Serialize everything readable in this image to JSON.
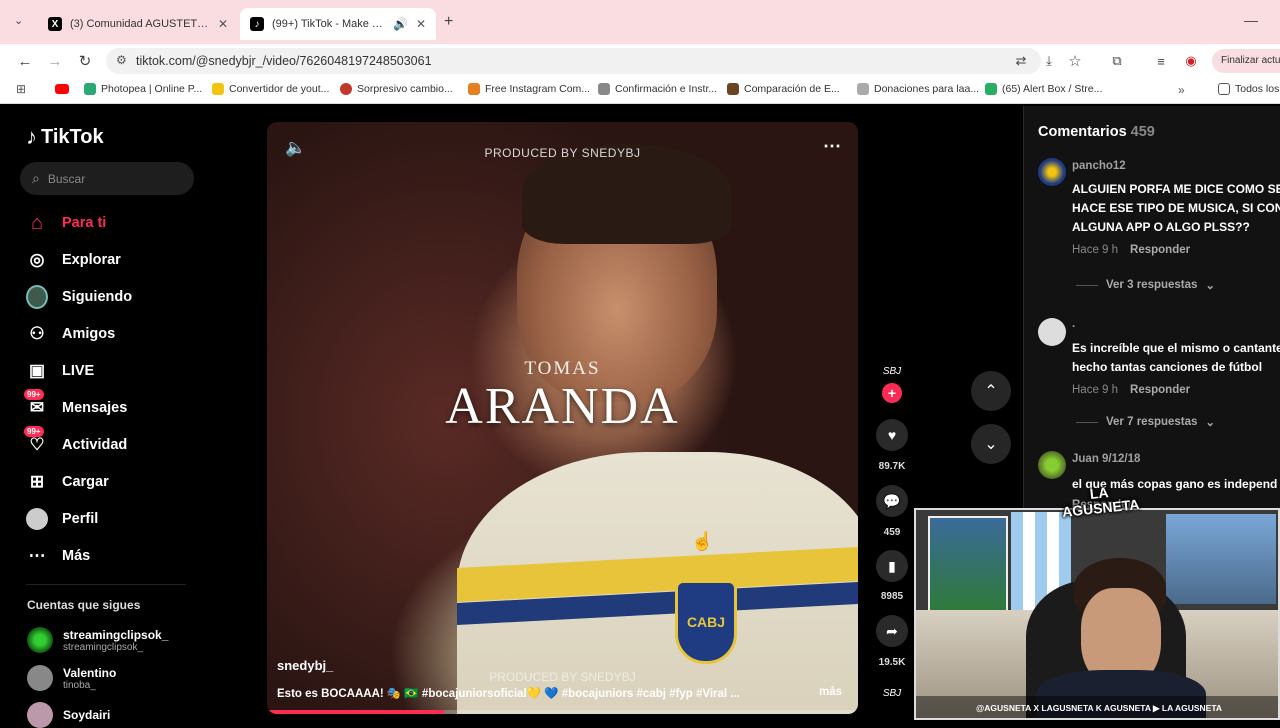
{
  "browser": {
    "tabs": [
      {
        "title": "(3) Comunidad AGUSTETISMO",
        "icon": "X"
      },
      {
        "title": "(99+) TikTok - Make Your Da",
        "icon": "♪"
      }
    ],
    "url": "tiktok.com/@snedybjr_/video/7626048197248503061",
    "finalize_label": "Finalizar actu",
    "bookmarks": [
      "Photopea | Online P...",
      "Convertidor de yout...",
      "Sorpresivo cambio...",
      "Free Instagram Com...",
      "Confirmación e Instr...",
      "Comparación de E...",
      "Donaciones para laa...",
      "(65) Alert Box / Stre..."
    ],
    "bookmarks_all": "Todos los"
  },
  "tiktok": {
    "logo": "TikTok",
    "search_placeholder": "Buscar",
    "menu": [
      {
        "label": "Para ti",
        "icon": "⌂",
        "active": true
      },
      {
        "label": "Explorar",
        "icon": "◎"
      },
      {
        "label": "Siguiendo",
        "icon": "●"
      },
      {
        "label": "Amigos",
        "icon": "⚇"
      },
      {
        "label": "LIVE",
        "icon": "▣"
      },
      {
        "label": "Mensajes",
        "icon": "✉",
        "badge": "99+"
      },
      {
        "label": "Actividad",
        "icon": "♡",
        "badge": "99+"
      },
      {
        "label": "Cargar",
        "icon": "⊞"
      },
      {
        "label": "Perfil",
        "icon": "●"
      },
      {
        "label": "Más",
        "icon": "⋯"
      }
    ],
    "following_title": "Cuentas que sigues",
    "following": [
      {
        "name": "streamingclipsok_",
        "handle": "streamingclipsok_"
      },
      {
        "name": "Valentino",
        "handle": "tinoba_"
      },
      {
        "name": "Soydairi",
        "handle": ""
      }
    ]
  },
  "video": {
    "produced_top": "PRODUCED BY SNEDYBJ",
    "produced_bottom": "PRODUCED BY SNEDYBJ",
    "name_small": "TOMAS",
    "name_big": "ARANDA",
    "author": "snedybj_",
    "caption": "Esto es BOCAAAA! 🎭 🇧🇷 #bocajuniorsoficial💛 💙 #bocajuniors #cabj #fyp #Viral ...",
    "more": "más",
    "crest": "CABJ",
    "likes": "89.7K",
    "comments": "459",
    "saves": "8985",
    "shares": "19.5K",
    "progress": 0.3
  },
  "comments": {
    "title": "Comentarios",
    "count": "459",
    "items": [
      {
        "user": "pancho12",
        "lines": [
          "ALGUIEN PORFA ME DICE COMO SE",
          "HACE ESE TIPO DE MUSICA, SI CON",
          "ALGUNA APP O ALGO PLSS??"
        ],
        "time": "Hace 9 h",
        "reply": "Responder",
        "replies": "Ver 3 respuestas"
      },
      {
        "user": ".",
        "lines": [
          "Es increíble que el mismo o cantante",
          "hecho tantas canciones de fútbol"
        ],
        "time": "Hace 9 h",
        "reply": "Responder",
        "replies": "Ver 7 respuestas"
      },
      {
        "user": "Juan 9/12/18",
        "lines": [
          "el que más copas gano es independ"
        ],
        "time": "",
        "reply": "Responder",
        "replies": ""
      }
    ]
  },
  "stream": {
    "brand": "LA AGUSNETA",
    "socials": "@AGUSNETA  X LAGUSNETA  K AGUSNETA  ▶ LA AGUSNETA"
  },
  "colors": {
    "accent": "#fe2c55",
    "tabbar": "#f9dde0"
  }
}
